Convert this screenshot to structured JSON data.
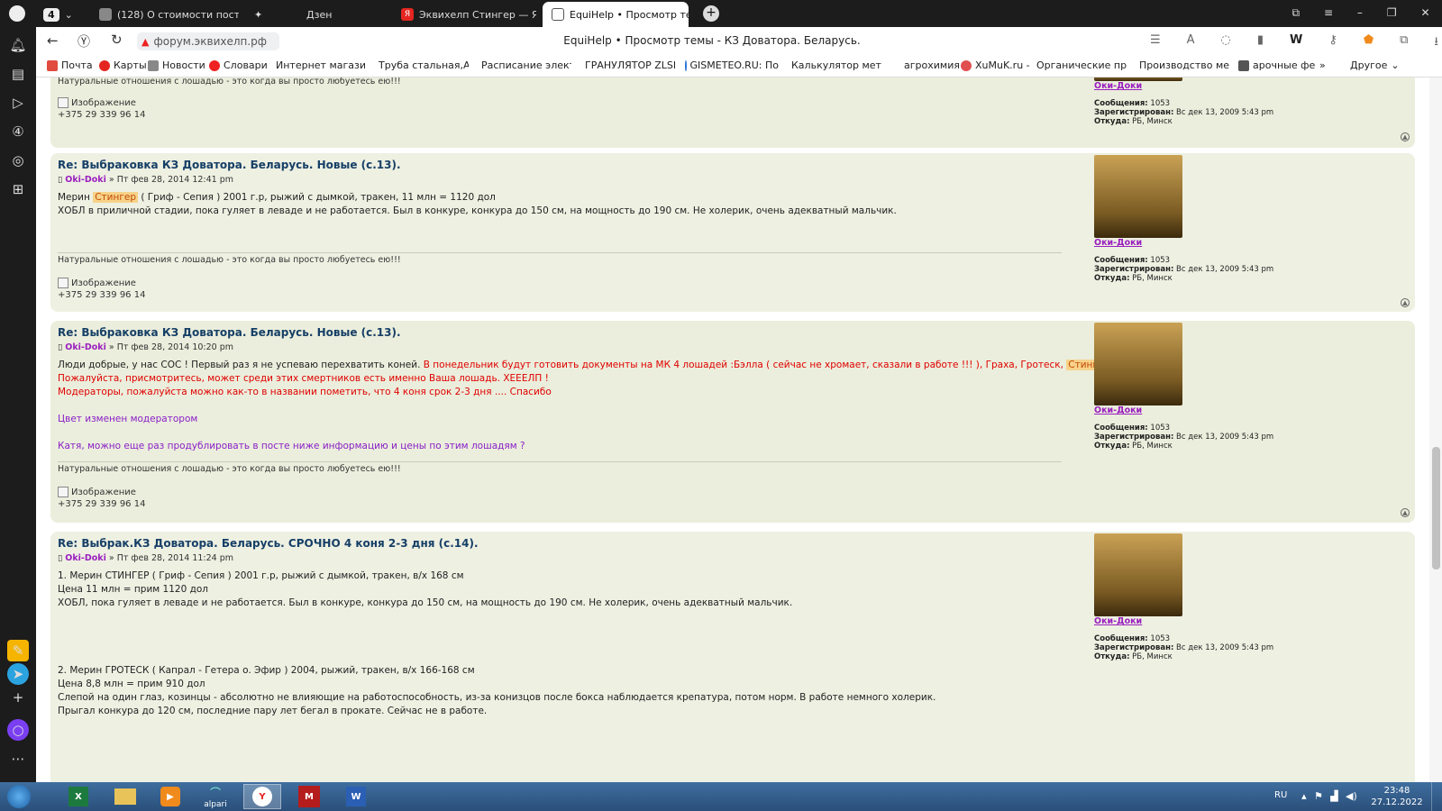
{
  "tabs": [
    {
      "count": "4"
    },
    {
      "title": "(128) О стоимости постоя"
    },
    {
      "title": "Дзен"
    },
    {
      "title": "Эквихелп Стингер — Янд"
    },
    {
      "title": "EquiHelp • Просмотр те"
    }
  ],
  "address": {
    "url": "форум.эквихелп.рф",
    "page_title": "EquiHelp • Просмотр темы - КЗ Доватора. Беларусь."
  },
  "bookmarks": [
    "Почта",
    "Карты",
    "Новости",
    "Словари",
    "Интернет магазин",
    "Труба стальная,Ар",
    "Расписание элект",
    "ГРАНУЛЯТОР ZLSP",
    "GISMETEO.RU: По",
    "Калькулятор мета",
    "агрохимия",
    "XuMuK.ru -",
    "Органические пр",
    "Производство ме",
    "арочные фе"
  ],
  "bookmarks_more": "Другое",
  "sig_text": "Натуральные отношения с лошадью - это когда вы просто любуетесь ею!!!",
  "image_alt": "Изображение",
  "phone": "+375 29 339 96 14",
  "user": {
    "name": "Оки-Доки",
    "msgs_label": "Сообщения:",
    "msgs": "1053",
    "reg_label": "Зарегистрирован:",
    "reg": "Вс дек 13, 2009 5:43 pm",
    "from_label": "Откуда:",
    "from": "РБ, Минск"
  },
  "posts": [
    {
      "title": "Re: Выбраковка КЗ Доватора. Беларусь. Новые (с.13).",
      "author": "Oki-Doki",
      "date": "» Пт фев 28, 2014 12:41 pm",
      "line1a": "Мерин ",
      "line1hl": "Стингер",
      "line1b": " ( Гриф - Сепия ) 2001 г.р, рыжий с дымкой, тракен, 11 млн = 1120 дол",
      "line2": "ХОБЛ в приличной стадии, пока гуляет в леваде и не работается. Был в конкуре, конкура до 150 см, на мощность до 190 см. Не холерик, очень адекватный мальчик."
    },
    {
      "title": "Re: Выбраковка КЗ Доватора. Беларусь. Новые (с.13).",
      "author": "Oki-Doki",
      "date": "» Пт фев 28, 2014 10:20 pm",
      "line1a": "Люди добрые, у нас СОС ! Первый раз я не успеваю перехватить коней. ",
      "line1red": "В понедельник будут готовить документы на МК 4 лошадей :Бэлла ( сейчас не хромает, сказали в работе !!! ), Граха, Гротеск, ",
      "line1hl": "Стингер",
      "line1dot": ".",
      "line2": "Пожалуйста, присмотритесь, может среди этих смертников есть именно Ваша лошадь. ХЕЕЕЛП !",
      "line3": "Модераторы, пожалуйста можно как-то в названии пометить, что 4 коня срок 2-3 дня .... Спасибо",
      "line4": "Цвет изменен модератором",
      "line5": "Катя, можно еще раз продублировать в посте ниже информацию и цены по этим лошадям ?"
    },
    {
      "title": "Re: Выбрак.КЗ Доватора. Беларусь. СРОЧНО 4 коня 2-3 дня (с.14).",
      "author": "Oki-Doki",
      "date": "» Пт фев 28, 2014 11:24 pm",
      "l1": "1. Мерин СТИНГЕР ( Гриф - Сепия ) 2001 г.р, рыжий с дымкой, тракен, в/х 168 см",
      "l2": "Цена 11 млн = прим 1120 дол",
      "l3": "ХОБЛ, пока гуляет в леваде и не работается. Был в конкуре, конкура до 150 см, на мощность до 190 см. Не холерик, очень адекватный мальчик.",
      "l4": "2. Мерин ГРОТЕСК ( Капрал - Гетера о. Эфир ) 2004, рыжий, тракен, в/х 166-168 см",
      "l5": "Цена 8,8 млн = прим 910 дол",
      "l6": "Слепой на один глаз, козинцы - абсолютно не влияющие на работоспособность, из-за конизцов после бокса наблюдается крепатура, потом норм. В работе немного холерик.",
      "l7": "Прыгал конкура до 120 см, последние пару лет бегал в прокате. Сейчас не в работе."
    }
  ],
  "taskbar": {
    "alpari": "alpari",
    "lang": "RU",
    "time": "23:48",
    "date": "27.12.2022"
  }
}
